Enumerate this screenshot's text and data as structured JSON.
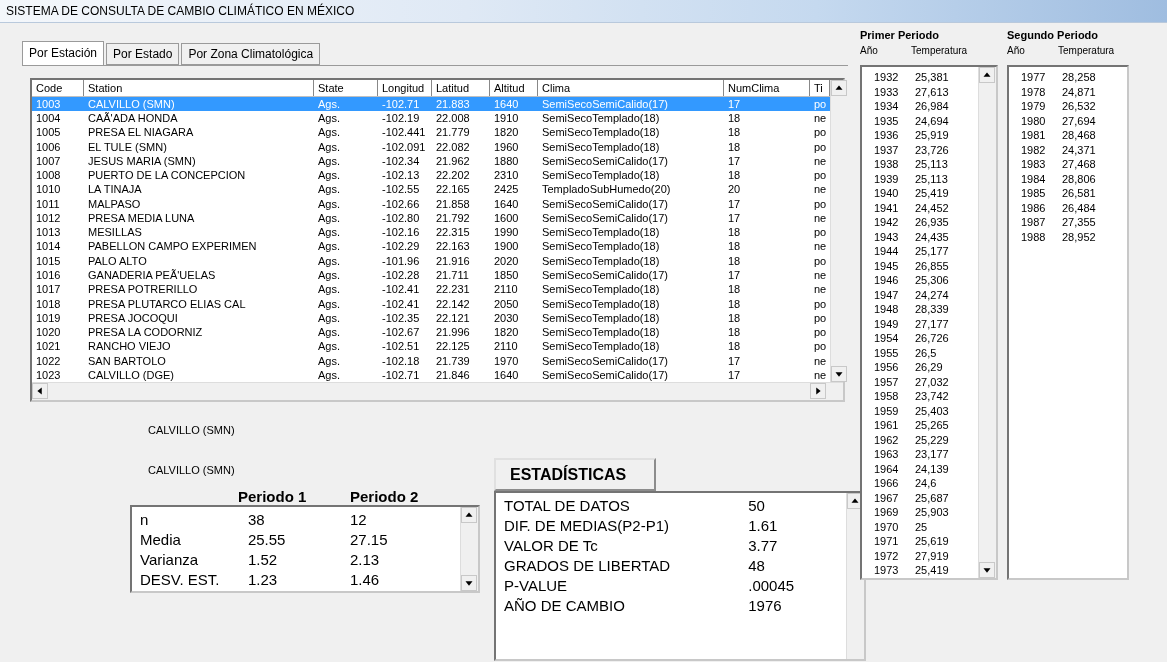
{
  "window": {
    "title": "SISTEMA DE CONSULTA DE CAMBIO CLIMÁTICO EN MÉXICO"
  },
  "tabs": [
    {
      "label": "Por Estación",
      "selected": true
    },
    {
      "label": "Por Estado",
      "selected": false
    },
    {
      "label": "Por Zona Climatológica",
      "selected": false
    }
  ],
  "stations": {
    "columns": [
      "Code",
      "Station",
      "State",
      "Longitud",
      "Latitud",
      "Altitud",
      "Clima",
      "NumClima",
      "Ti"
    ],
    "rows": [
      {
        "selected": true,
        "cells": [
          "1003",
          "CALVILLO (SMN)",
          "Ags.",
          "-102.71",
          "21.883",
          "1640",
          "SemiSecoSemiCalido(17)",
          "17",
          "po"
        ]
      },
      {
        "selected": false,
        "cells": [
          "1004",
          "CAÃ'ADA HONDA",
          "Ags.",
          "-102.19",
          "22.008",
          "1910",
          "SemiSecoTemplado(18)",
          "18",
          "ne"
        ]
      },
      {
        "selected": false,
        "cells": [
          "1005",
          "PRESA EL NIAGARA",
          "Ags.",
          "-102.441",
          "21.779",
          "1820",
          "SemiSecoTemplado(18)",
          "18",
          "po"
        ]
      },
      {
        "selected": false,
        "cells": [
          "1006",
          "EL TULE (SMN)",
          "Ags.",
          "-102.091",
          "22.082",
          "1960",
          "SemiSecoTemplado(18)",
          "18",
          "po"
        ]
      },
      {
        "selected": false,
        "cells": [
          "1007",
          "JESUS MARIA (SMN)",
          "Ags.",
          "-102.34",
          "21.962",
          "1880",
          "SemiSecoSemiCalido(17)",
          "17",
          "ne"
        ]
      },
      {
        "selected": false,
        "cells": [
          "1008",
          "PUERTO DE LA CONCEPCION",
          "Ags.",
          "-102.13",
          "22.202",
          "2310",
          "SemiSecoTemplado(18)",
          "18",
          "po"
        ]
      },
      {
        "selected": false,
        "cells": [
          "1010",
          "LA TINAJA",
          "Ags.",
          "-102.55",
          "22.165",
          "2425",
          "TempladoSubHumedo(20)",
          "20",
          "ne"
        ]
      },
      {
        "selected": false,
        "cells": [
          "1011",
          "MALPASO",
          "Ags.",
          "-102.66",
          "21.858",
          "1640",
          "SemiSecoSemiCalido(17)",
          "17",
          "po"
        ]
      },
      {
        "selected": false,
        "cells": [
          "1012",
          "PRESA MEDIA LUNA",
          "Ags.",
          "-102.80",
          "21.792",
          "1600",
          "SemiSecoSemiCalido(17)",
          "17",
          "ne"
        ]
      },
      {
        "selected": false,
        "cells": [
          "1013",
          "MESILLAS",
          "Ags.",
          "-102.16",
          "22.315",
          "1990",
          "SemiSecoTemplado(18)",
          "18",
          "po"
        ]
      },
      {
        "selected": false,
        "cells": [
          "1014",
          "PABELLON CAMPO EXPERIMEN",
          "Ags.",
          "-102.29",
          "22.163",
          "1900",
          "SemiSecoTemplado(18)",
          "18",
          "ne"
        ]
      },
      {
        "selected": false,
        "cells": [
          "1015",
          "PALO ALTO",
          "Ags.",
          "-101.96",
          "21.916",
          "2020",
          "SemiSecoTemplado(18)",
          "18",
          "po"
        ]
      },
      {
        "selected": false,
        "cells": [
          "1016",
          "GANADERIA PEÃ'UELAS",
          "Ags.",
          "-102.28",
          "21.711",
          "1850",
          "SemiSecoSemiCalido(17)",
          "17",
          "ne"
        ]
      },
      {
        "selected": false,
        "cells": [
          "1017",
          "PRESA POTRERILLO",
          "Ags.",
          "-102.41",
          "22.231",
          "2110",
          "SemiSecoTemplado(18)",
          "18",
          "ne"
        ]
      },
      {
        "selected": false,
        "cells": [
          "1018",
          "PRESA PLUTARCO ELIAS CAL",
          "Ags.",
          "-102.41",
          "22.142",
          "2050",
          "SemiSecoTemplado(18)",
          "18",
          "po"
        ]
      },
      {
        "selected": false,
        "cells": [
          "1019",
          "PRESA JOCOQUI",
          "Ags.",
          "-102.35",
          "22.121",
          "2030",
          "SemiSecoTemplado(18)",
          "18",
          "po"
        ]
      },
      {
        "selected": false,
        "cells": [
          "1020",
          "PRESA LA CODORNIZ",
          "Ags.",
          "-102.67",
          "21.996",
          "1820",
          "SemiSecoTemplado(18)",
          "18",
          "po"
        ]
      },
      {
        "selected": false,
        "cells": [
          "1021",
          "RANCHO VIEJO",
          "Ags.",
          "-102.51",
          "22.125",
          "2110",
          "SemiSecoTemplado(18)",
          "18",
          "po"
        ]
      },
      {
        "selected": false,
        "cells": [
          "1022",
          "SAN BARTOLO",
          "Ags.",
          "-102.18",
          "21.739",
          "1970",
          "SemiSecoSemiCalido(17)",
          "17",
          "ne"
        ]
      },
      {
        "selected": false,
        "cells": [
          "1023",
          "CALVILLO (DGE)",
          "Ags.",
          "-102.71",
          "21.846",
          "1640",
          "SemiSecoSemiCalido(17)",
          "17",
          "ne"
        ]
      }
    ]
  },
  "station_labels": [
    "CALVILLO (SMN)",
    "CALVILLO (SMN)"
  ],
  "period_summary": {
    "columns": [
      "Periodo 1",
      "Periodo 2"
    ],
    "rows": [
      {
        "label": "n",
        "values": [
          "38",
          "12"
        ]
      },
      {
        "label": "Media",
        "values": [
          "25.55",
          "27.15"
        ]
      },
      {
        "label": "Varianza",
        "values": [
          "1.52",
          "2.13"
        ]
      },
      {
        "label": "DESV. EST.",
        "values": [
          "1.23",
          "1.46"
        ]
      }
    ]
  },
  "statistics": {
    "button": "ESTADÍSTICAS",
    "rows": [
      {
        "label": "TOTAL DE DATOS",
        "value": "50"
      },
      {
        "label": "DIF. DE MEDIAS(P2-P1)",
        "value": "1.61"
      },
      {
        "label": "VALOR DE Tc",
        "value": "3.77"
      },
      {
        "label": "GRADOS DE LIBERTAD",
        "value": "48"
      },
      {
        "label": "P-VALUE",
        "value": ".00045"
      },
      {
        "label": "AÑO DE CAMBIO",
        "value": "1976"
      }
    ]
  },
  "first_period": {
    "title": "Primer Periodo",
    "columns": [
      "Año",
      "Temperatura"
    ],
    "rows": [
      [
        "1932",
        "25,381"
      ],
      [
        "1933",
        "27,613"
      ],
      [
        "1934",
        "26,984"
      ],
      [
        "1935",
        "24,694"
      ],
      [
        "1936",
        "25,919"
      ],
      [
        "1937",
        "23,726"
      ],
      [
        "1938",
        "25,113"
      ],
      [
        "1939",
        "25,113"
      ],
      [
        "1940",
        "25,419"
      ],
      [
        "1941",
        "24,452"
      ],
      [
        "1942",
        "26,935"
      ],
      [
        "1943",
        "24,435"
      ],
      [
        "1944",
        "25,177"
      ],
      [
        "1945",
        "26,855"
      ],
      [
        "1946",
        "25,306"
      ],
      [
        "1947",
        "24,274"
      ],
      [
        "1948",
        "28,339"
      ],
      [
        "1949",
        "27,177"
      ],
      [
        "1954",
        "26,726"
      ],
      [
        "1955",
        "26,5"
      ],
      [
        "1956",
        "26,29"
      ],
      [
        "1957",
        "27,032"
      ],
      [
        "1958",
        "23,742"
      ],
      [
        "1959",
        "25,403"
      ],
      [
        "1961",
        "25,265"
      ],
      [
        "1962",
        "25,229"
      ],
      [
        "1963",
        "23,177"
      ],
      [
        "1964",
        "24,139"
      ],
      [
        "1966",
        "24,6"
      ],
      [
        "1967",
        "25,687"
      ],
      [
        "1969",
        "25,903"
      ],
      [
        "1970",
        "25"
      ],
      [
        "1971",
        "25,619"
      ],
      [
        "1972",
        "27,919"
      ],
      [
        "1973",
        "25,419"
      ]
    ]
  },
  "second_period": {
    "title": "Segundo Periodo",
    "columns": [
      "Año",
      "Temperatura"
    ],
    "rows": [
      [
        "1977",
        "28,258"
      ],
      [
        "1978",
        "24,871"
      ],
      [
        "1979",
        "26,532"
      ],
      [
        "1980",
        "27,694"
      ],
      [
        "1981",
        "28,468"
      ],
      [
        "1982",
        "24,371"
      ],
      [
        "1983",
        "27,468"
      ],
      [
        "1984",
        "28,806"
      ],
      [
        "1985",
        "26,581"
      ],
      [
        "1986",
        "26,484"
      ],
      [
        "1987",
        "27,355"
      ],
      [
        "1988",
        "28,952"
      ]
    ]
  }
}
